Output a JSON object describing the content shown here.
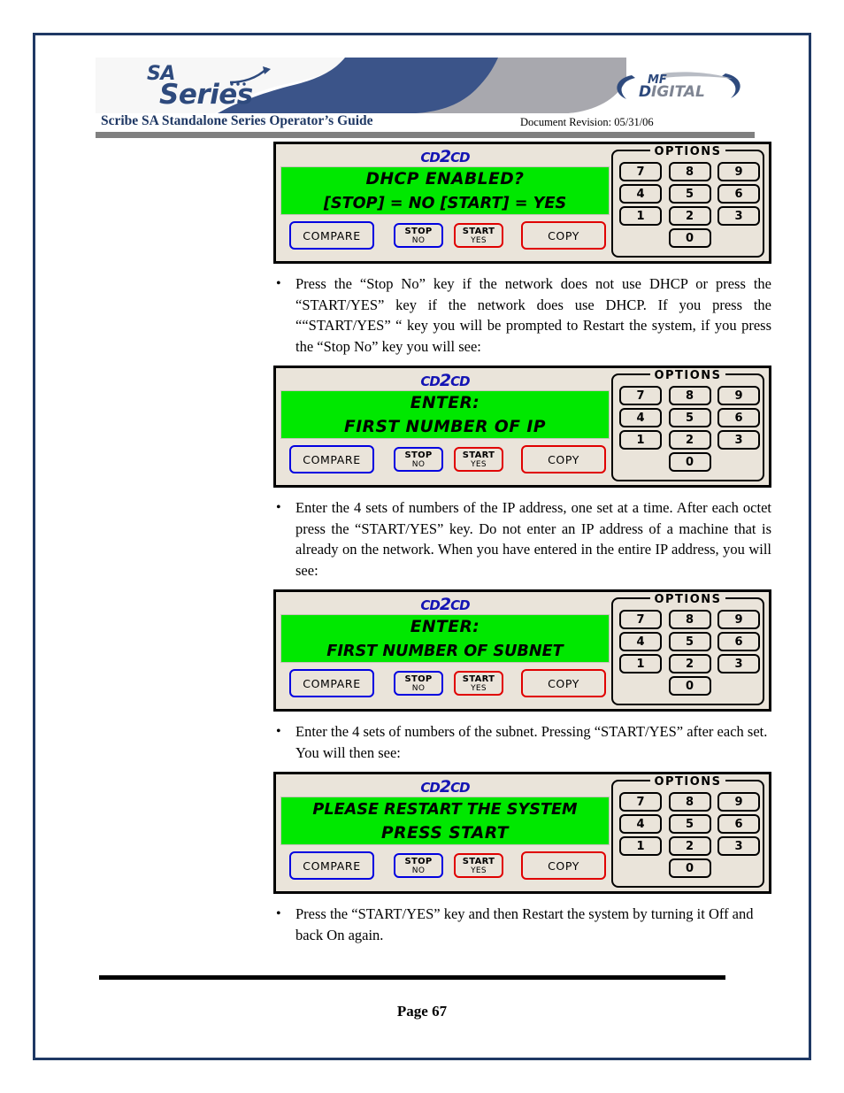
{
  "header": {
    "logo_sa_top": "SA",
    "logo_sa_bottom": "Series",
    "mf_logo_top": "MF",
    "mf_logo_bottom": "DIGITAL",
    "guide_title": "Scribe SA Standalone Series Operator’s Guide",
    "doc_revision": "Document Revision: 05/31/06",
    "accent_navy": "#1F3864",
    "banner_blue": "#3B5489",
    "banner_gray": "#A8A8AE"
  },
  "panels": [
    {
      "brand": "cd2cd",
      "lcd_lines": [
        "DHCP ENABLED?",
        "[STOP] = NO  [START] = YES"
      ],
      "lcd_color": "#00E800"
    },
    {
      "brand": "cd2cd",
      "lcd_lines": [
        "ENTER:",
        "FIRST NUMBER OF IP"
      ],
      "lcd_color": "#00E800"
    },
    {
      "brand": "cd2cd",
      "lcd_lines": [
        "ENTER:",
        "FIRST NUMBER OF SUBNET"
      ],
      "lcd_color": "#00E800"
    },
    {
      "brand": "cd2cd",
      "lcd_lines": [
        "PLEASE RESTART THE SYSTEM",
        "PRESS START"
      ],
      "lcd_color": "#00E800"
    }
  ],
  "device_controls": {
    "compare_label": "COMPARE",
    "stop_label_top": "STOP",
    "stop_label_bottom": "NO",
    "start_label_top": "START",
    "start_label_bottom": "YES",
    "copy_label": "COPY",
    "options_title": "OPTIONS",
    "keys": [
      "7",
      "8",
      "9",
      "4",
      "5",
      "6",
      "1",
      "2",
      "3",
      "0"
    ],
    "blue_border": "#0000E0",
    "red_border": "#E00000"
  },
  "bullets": [
    "Press the “Stop No” key if the network does not use DHCP or press the “START/YES” key if the network does use DHCP. If you press the ““START/YES” “ key you will be prompted to Restart the system, if you press the “Stop No” key you will see:",
    "Enter the 4 sets of numbers of the IP address, one set at a time. After each octet press the “START/YES” key. Do not enter an IP address of a machine that is already on the network. When you have entered in the entire IP address, you will see:",
    "Enter the 4 sets of numbers of the subnet. Pressing “START/YES” after each set. You will then see:",
    "Press the “START/YES” key and then Restart the system by turning it Off and back On again."
  ],
  "bullet_marker": "•",
  "footer": {
    "page_label": "Page 67"
  }
}
